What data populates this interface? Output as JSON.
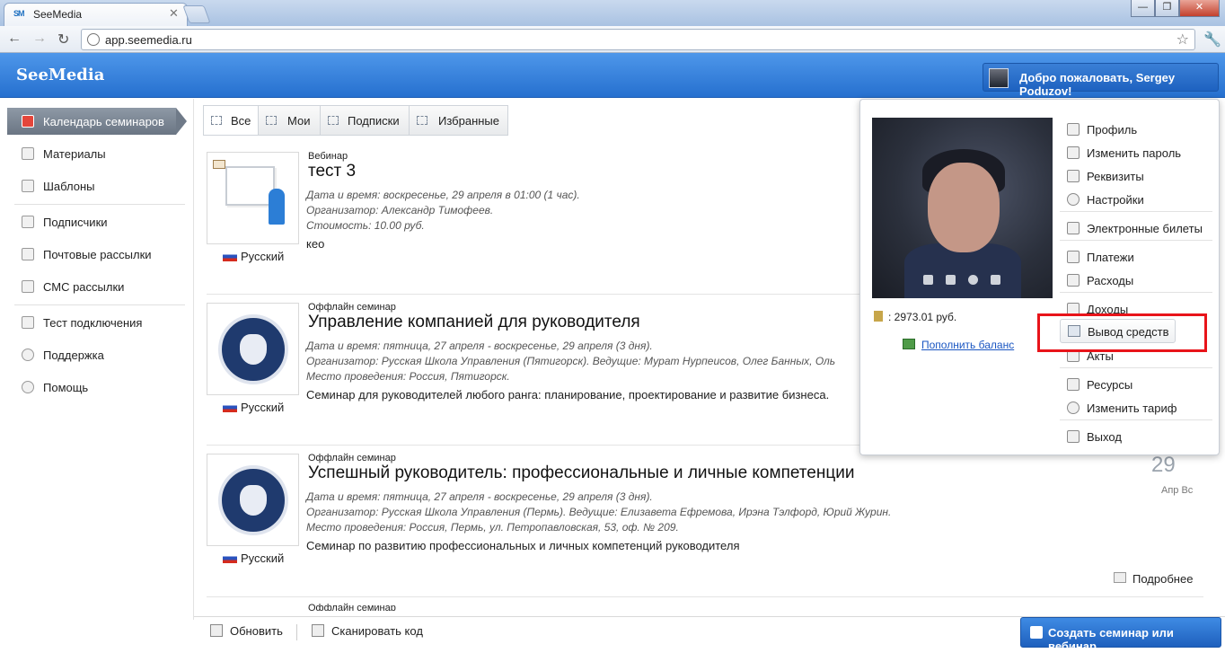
{
  "browser": {
    "tab_icon": "SM",
    "tab_title": "SeeMedia",
    "url": "app.seemedia.ru"
  },
  "header": {
    "logo": "SeeMedia",
    "welcome": "Добро пожаловать, Sergey Poduzov!"
  },
  "sidebar": {
    "items": [
      {
        "label": "Календарь семинаров",
        "icon": "calendar-icon",
        "active": true
      },
      {
        "label": "Материалы",
        "icon": "materials-icon"
      },
      {
        "label": "Шаблоны",
        "icon": "templates-icon"
      },
      {
        "label": "Подписчики",
        "icon": "subscribers-icon"
      },
      {
        "label": "Почтовые рассылки",
        "icon": "mail-icon"
      },
      {
        "label": "СМС рассылки",
        "icon": "sms-icon"
      },
      {
        "label": "Тест подключения",
        "icon": "connection-test-icon"
      },
      {
        "label": "Поддержка",
        "icon": "support-icon"
      },
      {
        "label": "Помощь",
        "icon": "help-icon"
      }
    ]
  },
  "filters": {
    "tabs": [
      {
        "label": "Все",
        "active": true
      },
      {
        "label": "Мои"
      },
      {
        "label": "Подписки"
      },
      {
        "label": "Избранные"
      }
    ]
  },
  "events": [
    {
      "kind": "Вебинар",
      "title": "тест 3",
      "date": "Дата и время: воскресенье, 29 апреля в 01:00 (1 час).",
      "organizer": "Организатор: Александр Тимофеев.",
      "price": "Стоимость: 10.00 руб.",
      "description": "кео",
      "language": "Русский"
    },
    {
      "kind": "Оффлайн семинар",
      "title": "Управление компанией для руководителя",
      "date": "Дата и время: пятница, 27 апреля - воскресенье, 29 апреля (3 дня).",
      "organizer": "Организатор: Русская Школа Управления (Пятигорск). Ведущие: Мурат Нурпеисов, Олег Банных, Оль",
      "place": "Место проведения: Россия, Пятигорск.",
      "description": "Семинар для руководителей любого ранга: планирование, проектирование и развитие бизнеса.",
      "language": "Русский"
    },
    {
      "kind": "Оффлайн семинар",
      "title": "Успешный руководитель: профессиональные и личные компетенции",
      "date": "Дата и время: пятница, 27 апреля - воскресенье, 29 апреля (3 дня).",
      "organizer": "Организатор: Русская Школа Управления (Пермь). Ведущие: Елизавета Ефремова, Ирэна Тэлфорд, Юрий Журин.",
      "place": "Место проведения: Россия, Пермь, ул. Петропавловская, 53, оф. № 209.",
      "description": "Семинар по развитию профессиональных и личных компетенций руководителя",
      "language": "Русский",
      "day": "29",
      "month": "Апр Вс",
      "more": "Подробнее"
    }
  ],
  "partial_next_kind": "Оффлайн семинар",
  "profile_popup": {
    "balance": ": 2973.01 руб.",
    "topup": "Пополнить баланс",
    "menu": [
      {
        "label": "Профиль",
        "icon": "profile-icon"
      },
      {
        "label": "Изменить пароль",
        "icon": "password-icon"
      },
      {
        "label": "Реквизиты",
        "icon": "requisites-icon"
      },
      {
        "label": "Настройки",
        "icon": "settings-icon"
      },
      {
        "label": "Электронные билеты",
        "icon": "tickets-icon"
      },
      {
        "label": "Платежи",
        "icon": "payments-icon"
      },
      {
        "label": "Расходы",
        "icon": "expenses-icon"
      },
      {
        "label": "Доходы",
        "icon": "income-icon"
      },
      {
        "label": "Вывод средств",
        "icon": "withdraw-icon",
        "highlighted": true
      },
      {
        "label": "Акты",
        "icon": "acts-icon"
      },
      {
        "label": "Ресурсы",
        "icon": "resources-icon"
      },
      {
        "label": "Изменить тариф",
        "icon": "tariff-icon"
      },
      {
        "label": "Выход",
        "icon": "exit-icon"
      }
    ],
    "highlight_color": "#e8141a"
  },
  "footer": {
    "refresh": "Обновить",
    "scan": "Сканировать код",
    "create": "Создать семинар или вебинар"
  },
  "colors": {
    "brand_blue": "#2670cf",
    "active_nav": "#7a8593"
  }
}
